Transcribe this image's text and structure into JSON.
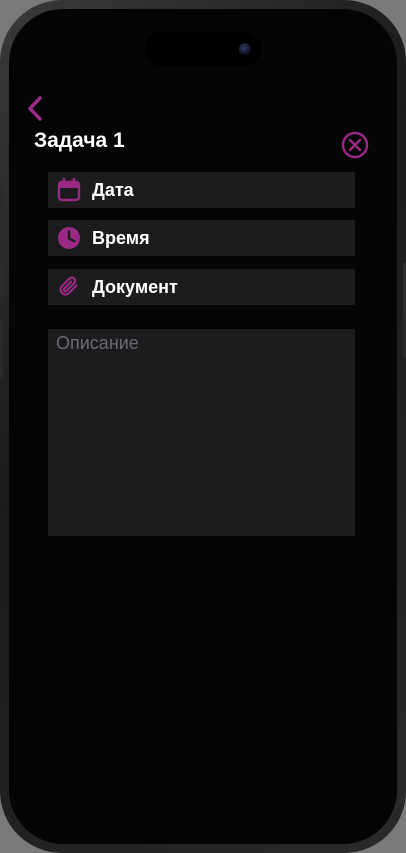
{
  "screen": {
    "title": "Задача 1"
  },
  "fields": {
    "date_label": "Дата",
    "time_label": "Время",
    "document_label": "Документ"
  },
  "description": {
    "value": "",
    "placeholder": "Описание"
  },
  "icons": {
    "back": "chevron-left-icon",
    "close": "close-circle-icon",
    "date": "calendar-icon",
    "time": "clock-icon",
    "document": "paperclip-icon"
  },
  "colors": {
    "accent": "#9a2a85",
    "background": "#050505",
    "field_background": "#1c1c1e",
    "text": "#ffffff",
    "placeholder": "#6b6b70"
  }
}
